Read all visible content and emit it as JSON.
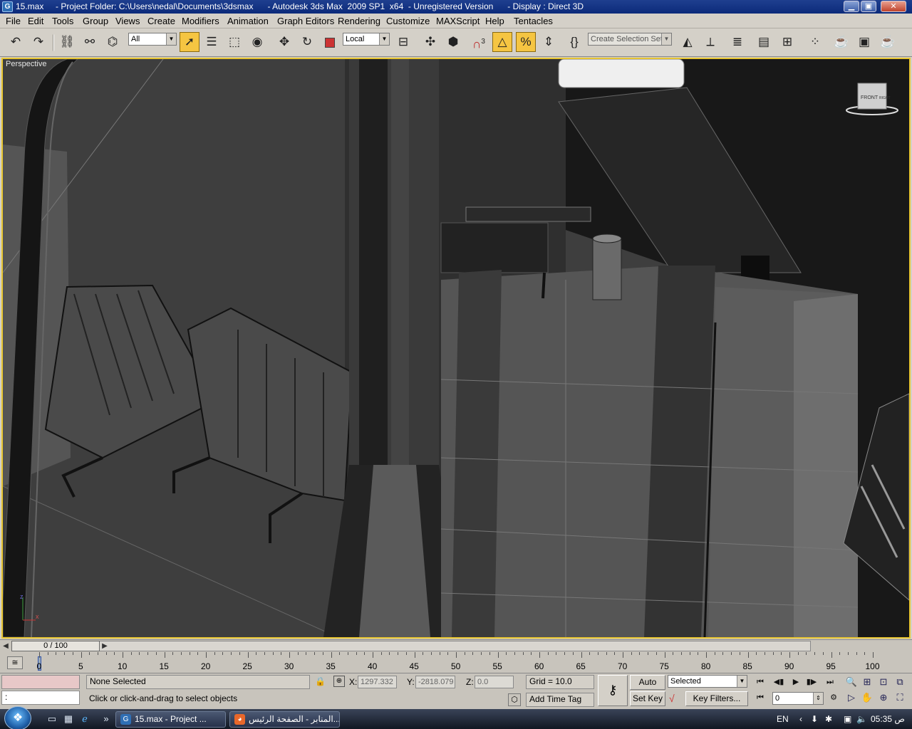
{
  "window": {
    "title": "15.max     - Project Folder: C:\\Users\\nedal\\Documents\\3dsmax      - Autodesk 3ds Max  2009 SP1  x64  - Unregistered Version      - Display : Direct 3D",
    "minimize": "▁",
    "maximize": "▣",
    "close": "✕"
  },
  "menu": [
    "File",
    "Edit",
    "Tools",
    "Group",
    "Views",
    "Create",
    "Modifiers",
    "Animation",
    "Graph Editors",
    "Rendering",
    "Customize",
    "MAXScript",
    "Help",
    "Tentacles"
  ],
  "toolbar": {
    "filter_value": "All",
    "coord_system": "Local",
    "snap_count": "3",
    "selection_set_placeholder": "Create Selection Set"
  },
  "viewport": {
    "label": "Perspective",
    "viewcube_front": "FRONT",
    "viewcube_side": "RIGHT",
    "axis_z": "z",
    "axis_x": "x"
  },
  "timeline": {
    "frame_display": "0 / 100",
    "ticks": [
      "0",
      "5",
      "10",
      "15",
      "20",
      "25",
      "30",
      "35",
      "40",
      "45",
      "50",
      "55",
      "60",
      "65",
      "70",
      "75",
      "80",
      "85",
      "90",
      "95",
      "100"
    ]
  },
  "status": {
    "script_prompt": ":",
    "selection": "None Selected",
    "prompt": "Click or click-and-drag to select objects",
    "x_label": "X:",
    "x_value": "1297.332",
    "y_label": "Y:",
    "y_value": "-2818.079",
    "z_label": "Z:",
    "z_value": "0.0",
    "grid": "Grid = 10.0",
    "add_time_tag": "Add Time Tag",
    "auto_key": "Auto Key",
    "set_key": "Set Key",
    "key_mode": "Selected",
    "key_filters": "Key Filters...",
    "current_frame": "0"
  },
  "taskbar": {
    "task1": "15.max     - Project ...",
    "task2": "المنابر - الصفحة الرئيس...",
    "lang": "EN",
    "clock": "05:35 ص"
  },
  "colors": {
    "titlebar": "#0b2a7a",
    "active_tool": "#f5c542",
    "viewport_border": "#e8c632",
    "viewport_bg": "#3d3d3d"
  }
}
